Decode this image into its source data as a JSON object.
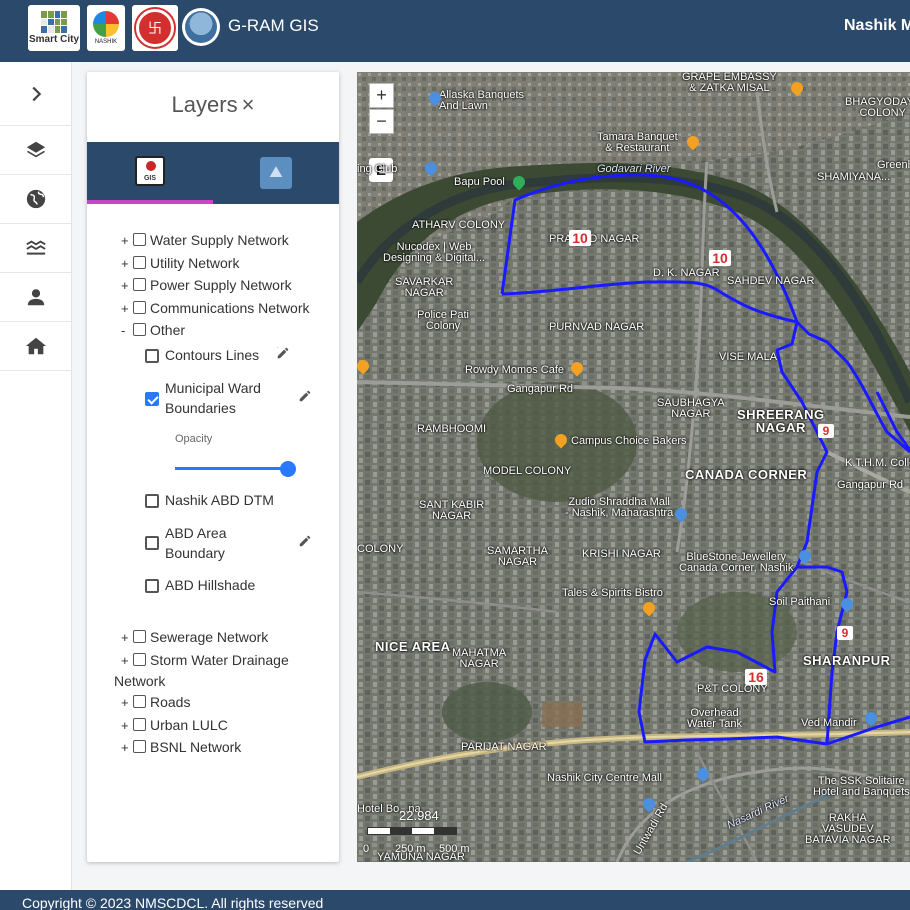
{
  "header": {
    "logos": [
      {
        "name": "smart-city-logo",
        "text": "Smart City"
      },
      {
        "name": "nashik-logo",
        "text": "NASHIK"
      },
      {
        "name": "nmc-seal-logo"
      },
      {
        "name": "gram-logo"
      }
    ],
    "app_title": "G-RAM GIS",
    "city_title": "Nashik M"
  },
  "rail": {
    "items": [
      {
        "name": "expand-chevron-icon"
      },
      {
        "name": "layers-icon"
      },
      {
        "name": "globe-icon"
      },
      {
        "name": "waves-icon"
      },
      {
        "name": "user-icon"
      },
      {
        "name": "home-icon"
      }
    ]
  },
  "panel": {
    "title": "Layers",
    "close_icon": "×",
    "tabs": [
      {
        "name": "gis-tab",
        "icon_text": "GIS",
        "active": true
      },
      {
        "name": "dem-tab",
        "active": false
      }
    ],
    "tree": [
      {
        "toggle": "+",
        "label": "Water Supply Network"
      },
      {
        "toggle": "+",
        "label": "Utility Network"
      },
      {
        "toggle": "+",
        "label": "Power Supply Network"
      },
      {
        "toggle": "+",
        "label": "Communications Network"
      },
      {
        "toggle": "-",
        "label": "Other"
      }
    ],
    "other_children": [
      {
        "label_1": "Contours Lines",
        "label_2": "",
        "checked": false,
        "edit": true
      },
      {
        "label_1": "Municipal Ward",
        "label_2": "Boundaries",
        "checked": true,
        "edit": true
      },
      {
        "label_1": "Nashik ABD DTM",
        "label_2": "",
        "checked": false,
        "edit": false
      },
      {
        "label_1": "ABD Area",
        "label_2": "Boundary",
        "checked": false,
        "edit": true
      },
      {
        "label_1": "ABD Hillshade",
        "label_2": "",
        "checked": false,
        "edit": false
      }
    ],
    "opacity_label": "Opacity",
    "opacity_value": 1.0,
    "tree_after": [
      {
        "toggle": "+",
        "label": "Sewerage Network"
      },
      {
        "toggle": "+",
        "label": "Storm Water Drainage",
        "label_2": "Network"
      },
      {
        "toggle": "+",
        "label": "Roads"
      },
      {
        "toggle": "+",
        "label": "Urban LULC"
      },
      {
        "toggle": "+",
        "label": "BSNL Network"
      }
    ]
  },
  "map": {
    "zoom_in": "+",
    "zoom_out": "−",
    "edit_button": "E",
    "labels": {
      "grape": "GRAPE EMBASSY\n& ZATKA MISAL",
      "allaska": "Allaska Banquets\nAnd Lawn",
      "bhagyodaya": "BHAGYODAYA\nCOLONY",
      "tamara": "Tamara Banquet\n& Restaurant",
      "club": "ing Club",
      "bapu": "Bapu Pool",
      "godavari": "Godavari River",
      "greenl": "Greenl",
      "shamiyana": "SHAMIYANA...",
      "atharv": "ATHARV COLONY",
      "nucodex": "Nucodex | Web\nDesigning & Digital...",
      "pramod": "PRAMOD NAGAR",
      "dk": "D. K. NAGAR",
      "sahdev": "SAHDEV NAGAR",
      "savarkar": "SAVARKAR\nNAGAR",
      "police": "Police Pati\nColony",
      "purnvad": "PURNVAD NAGAR",
      "rowdy": "Rowdy Momos Cafe",
      "vise": "VISE MALA",
      "gangapur": "Gangapur Rd",
      "saubhagya": "SAUBHAGYA\nNAGAR",
      "shreerang": "SHREERANG\nNAGAR",
      "rambhoomi": "RAMBHOOMI",
      "campus": "Campus Choice Bakers",
      "model": "MODEL COLONY",
      "canada": "CANADA CORNER",
      "ktm": "K.T.H.M. College",
      "gangapur2": "Gangapur Rd",
      "santkabir": "SANT KABIR\nNAGAR",
      "zudio": "Zudio Shraddha Mall\n- Nashik, Maharashtra",
      "colony": "COLONY",
      "samartha": "SAMARTHA\nNAGAR",
      "krishi": "KRISHI NAGAR",
      "bluestone": "BlueStone Jewellery\nCanada Corner, Nashik",
      "tales": "Tales & Spirits Bistro",
      "soil": "Soil Paithani",
      "nicearea": "NICE AREA",
      "mahatma": "MAHATMA\nNAGAR",
      "sharanpur": "SHARANPUR",
      "pt": "P&T COLONY",
      "overhead": "Overhead\nWater Tank",
      "ved": "Ved Mandir",
      "parijat": "PARIJAT NAGAR",
      "citycentre": "Nashik City Centre Mall",
      "ssk": "The SSK Solitaire\nHotel and Banquets",
      "rakha": "RAKHA\nVASUDEV\nBATAVIA NAGAR",
      "hotel": "Hotel Bo...na",
      "yamuna": "YAMUNA NAGAR",
      "untwadi": "Untwadi Rd",
      "nasardi": "Nasardi River"
    },
    "wards": [
      "10",
      "10",
      "9",
      "9",
      "16"
    ],
    "scale": {
      "label": "22.984",
      "ticks": [
        "0",
        "250 m",
        "500 m"
      ]
    }
  },
  "footer": {
    "copyright": "Copyright © 2023 NMSCDCL. All rights reserved"
  }
}
